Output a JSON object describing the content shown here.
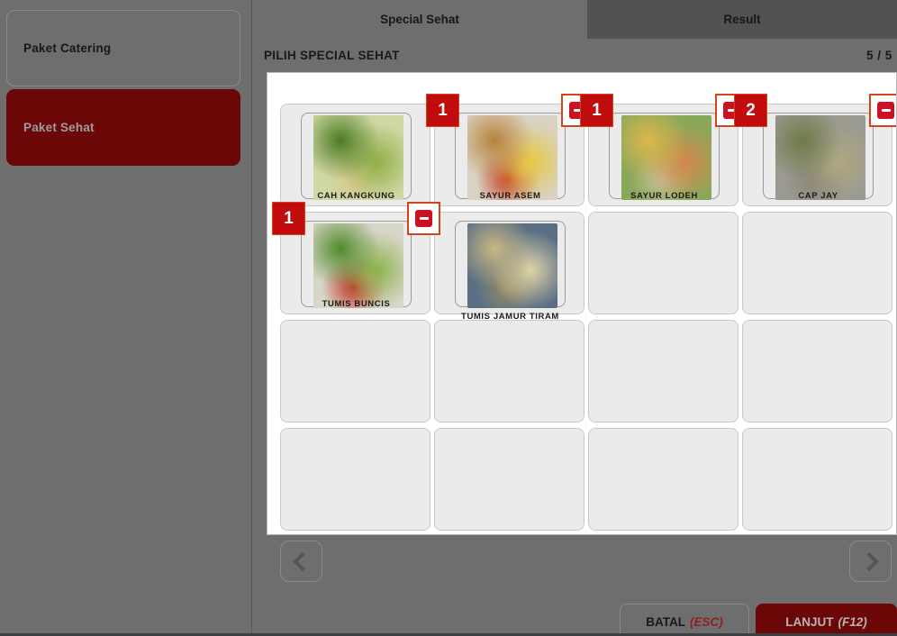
{
  "sidebar": {
    "items": [
      {
        "label": "Paket Catering",
        "state": "inactive"
      },
      {
        "label": "Paket Sehat",
        "state": "active"
      }
    ]
  },
  "tabs": [
    {
      "label": "Special Sehat",
      "active": true
    },
    {
      "label": "Result",
      "active": false
    }
  ],
  "section": {
    "title": "PILIH SPECIAL SEHAT",
    "counter": "5 / 5"
  },
  "grid": {
    "columns": 4,
    "rows": 4,
    "cards": [
      {
        "label": "CAH KANGKUNG",
        "qty": null,
        "has_minus": false,
        "empty": false,
        "img_colors": [
          "#cfd8a4",
          "#4c7a22",
          "#8fae46",
          "#d8c98e"
        ]
      },
      {
        "label": "SAYUR ASEM",
        "qty": "1",
        "has_minus": true,
        "empty": false,
        "img_colors": [
          "#d9d2c2",
          "#b8823a",
          "#e8c840",
          "#c43a20"
        ]
      },
      {
        "label": "SAYUR LODEH",
        "qty": "1",
        "has_minus": true,
        "empty": false,
        "img_colors": [
          "#8aa85a",
          "#e0b64c",
          "#d8874c",
          "#c8c29a"
        ]
      },
      {
        "label": "CAP JAY",
        "qty": "2",
        "has_minus": true,
        "empty": false,
        "img_colors": [
          "#9a9a90",
          "#6e7a48",
          "#b0a882",
          "#8a8274"
        ]
      },
      {
        "label": "TUMIS BUNCIS",
        "qty": "1",
        "has_minus": true,
        "empty": false,
        "img_colors": [
          "#d8d6c8",
          "#4f8a2a",
          "#8cb24a",
          "#c03020"
        ]
      },
      {
        "label": "TUMIS JAMUR TIRAM",
        "qty": null,
        "has_minus": false,
        "empty": false,
        "img_colors": [
          "#5a6f86",
          "#cbb882",
          "#e0d4a8",
          "#9a8e62"
        ]
      },
      {
        "label": "",
        "qty": null,
        "has_minus": false,
        "empty": true,
        "img_colors": []
      },
      {
        "label": "",
        "qty": null,
        "has_minus": false,
        "empty": true,
        "img_colors": []
      },
      {
        "label": "",
        "qty": null,
        "has_minus": false,
        "empty": true,
        "img_colors": []
      },
      {
        "label": "",
        "qty": null,
        "has_minus": false,
        "empty": true,
        "img_colors": []
      },
      {
        "label": "",
        "qty": null,
        "has_minus": false,
        "empty": true,
        "img_colors": []
      },
      {
        "label": "",
        "qty": null,
        "has_minus": false,
        "empty": true,
        "img_colors": []
      },
      {
        "label": "",
        "qty": null,
        "has_minus": false,
        "empty": true,
        "img_colors": []
      },
      {
        "label": "",
        "qty": null,
        "has_minus": false,
        "empty": true,
        "img_colors": []
      },
      {
        "label": "",
        "qty": null,
        "has_minus": false,
        "empty": true,
        "img_colors": []
      },
      {
        "label": "",
        "qty": null,
        "has_minus": false,
        "empty": true,
        "img_colors": []
      }
    ]
  },
  "pager": {
    "prev_icon": "chevron-left-icon",
    "next_icon": "chevron-right-icon"
  },
  "actions": {
    "cancel_label": "BATAL",
    "cancel_key": "(ESC)",
    "next_label": "LANJUT",
    "next_key": "(F12)"
  },
  "colors": {
    "background": "#6e6e6e",
    "tab_active_bg": "#6e6e6e",
    "tab_inactive_bg": "#525252",
    "accent_dark_red": "#6b0707",
    "badge_red": "#c00c0c",
    "minus_border": "#d6451a",
    "panel_bg": "#ffffff",
    "card_bg": "#ebebeb"
  }
}
